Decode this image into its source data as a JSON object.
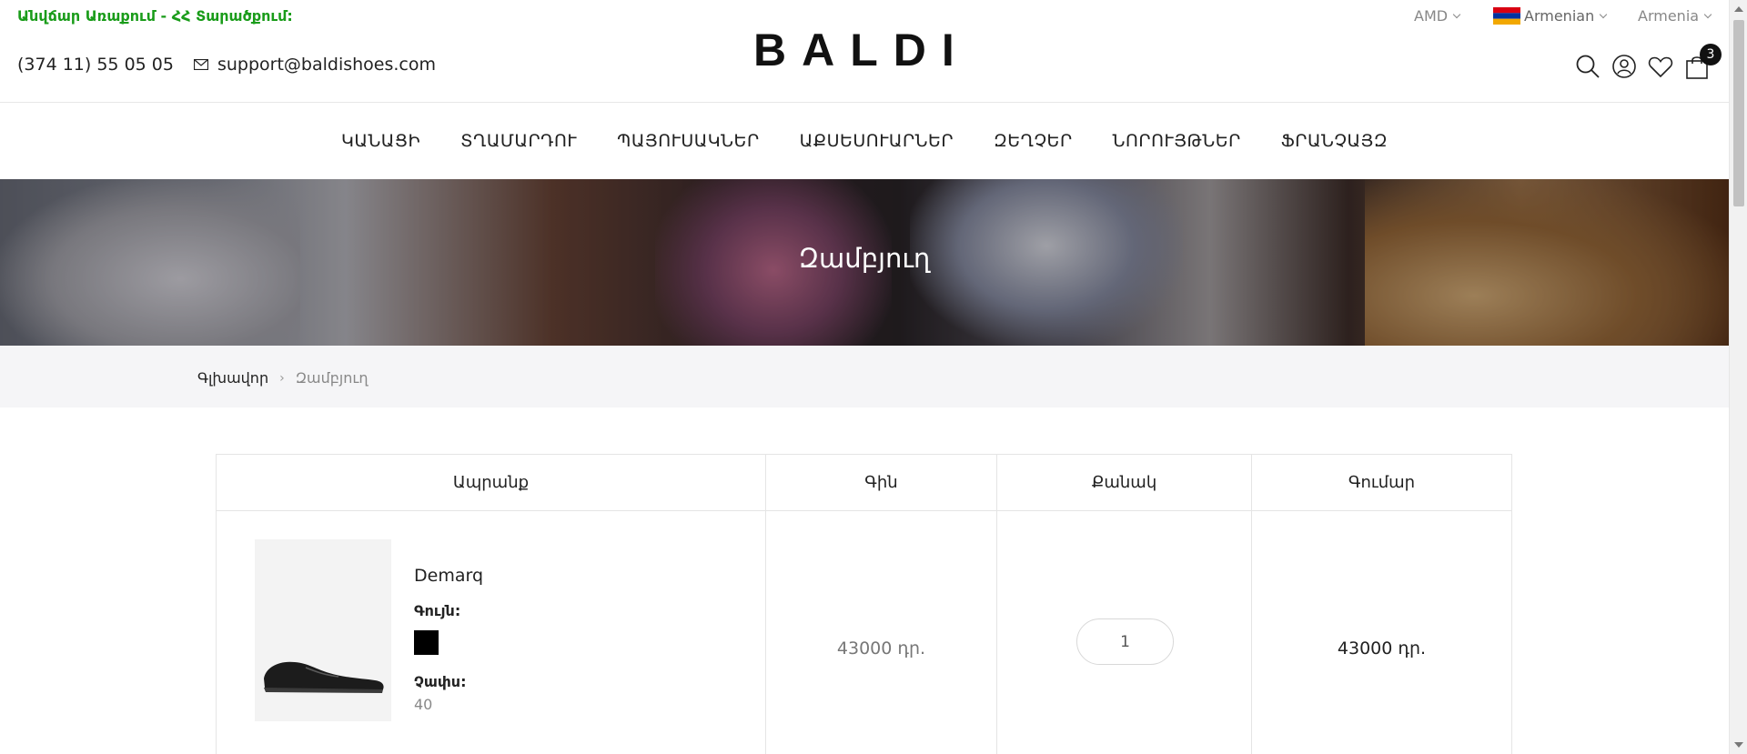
{
  "header": {
    "promo": "Անվճար Առաքում - ՀՀ Տարածքում:",
    "phone": "(374 11) 55 05 05",
    "email": "support@baldishoes.com",
    "logo": "BALDI",
    "currency": "AMD",
    "language": "Armenian",
    "country": "Armenia",
    "cart_count": "3"
  },
  "nav": {
    "items": [
      "ԿԱՆԱՑԻ",
      "ՏՂԱՄԱՐԴՈՒ",
      "ՊԱՅՈՒՍԱԿՆԵՐ",
      "ԱՔՍԵՍՈՒԱՐՆԵՐ",
      "ԶԵՂՉԵՐ",
      "ՆՈՐՈՒՅԹՆԵՐ",
      "ՖՐԱՆՉԱՅԶ"
    ]
  },
  "banner": {
    "title": "Զամբյուղ"
  },
  "breadcrumb": {
    "home": "Գլխավոր",
    "separator": "›",
    "current": "Զամբյուղ"
  },
  "cart": {
    "headers": {
      "product": "Ապրանք",
      "price": "Գին",
      "quantity": "Քանակ",
      "total": "Գումար"
    },
    "items": [
      {
        "name": "Demarq",
        "color_label": "Գույն:",
        "color": "#000000",
        "size_label": "Չափս:",
        "size": "40",
        "price": "43000 դր.",
        "quantity": "1",
        "total": "43000 դր."
      }
    ]
  },
  "colors": {
    "promo": "#1a9c1a",
    "text": "#222222",
    "muted": "#888888"
  }
}
